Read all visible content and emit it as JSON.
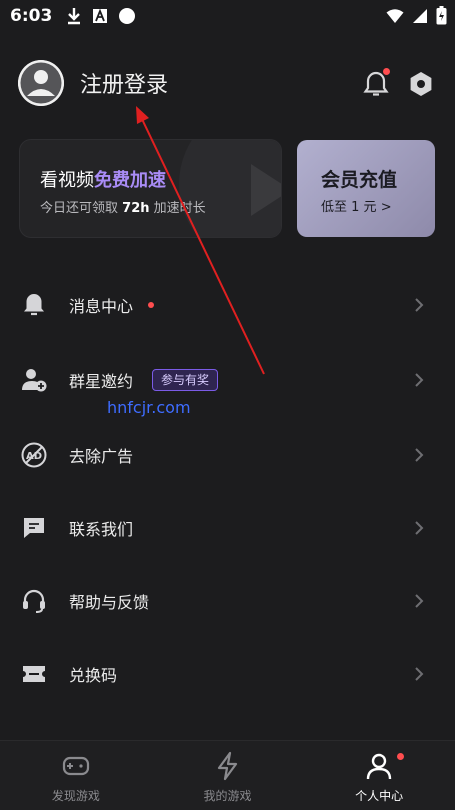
{
  "status_bar": {
    "time": "6:03",
    "icons": [
      "download-icon",
      "app-a-icon",
      "circle-icon",
      "wifi-icon",
      "signal-icon",
      "battery-charging-icon"
    ]
  },
  "profile": {
    "login_label": "注册登录",
    "icons": [
      "avatar-icon",
      "bell-icon",
      "settings-icon"
    ]
  },
  "promo": {
    "video_card": {
      "title_prefix": "看视频",
      "title_accent": "免费加速",
      "subtitle_prefix": "今日还可领取",
      "subtitle_value": "72h",
      "subtitle_suffix": "加速时长"
    },
    "vip_card": {
      "title": "会员充值",
      "subtitle": "低至 1 元",
      "chevron": ">"
    }
  },
  "menu": {
    "items": [
      {
        "label": "消息中心",
        "icon": "bell-icon",
        "has_dot": true
      },
      {
        "label": "群星邀约",
        "icon": "add-user-icon",
        "badge": "参与有奖"
      },
      {
        "label": "去除广告",
        "icon": "no-ads-icon"
      },
      {
        "label": "联系我们",
        "icon": "chat-icon"
      },
      {
        "label": "帮助与反馈",
        "icon": "headset-icon"
      },
      {
        "label": "兑换码",
        "icon": "ticket-icon"
      }
    ]
  },
  "watermark": "hnfcjr.com",
  "bottom_nav": {
    "tabs": [
      {
        "label": "发现游戏",
        "icon": "gamepad-icon",
        "active": false
      },
      {
        "label": "我的游戏",
        "icon": "lightning-icon",
        "active": false
      },
      {
        "label": "个人中心",
        "icon": "person-icon",
        "active": true,
        "has_dot": true
      }
    ]
  },
  "colors": {
    "background": "#1c1c1e",
    "accent_purple": "#a98cf6",
    "notification_red": "#ff4d4f",
    "arrow_red": "#e02020",
    "vip_card": "#a7a5c4"
  }
}
